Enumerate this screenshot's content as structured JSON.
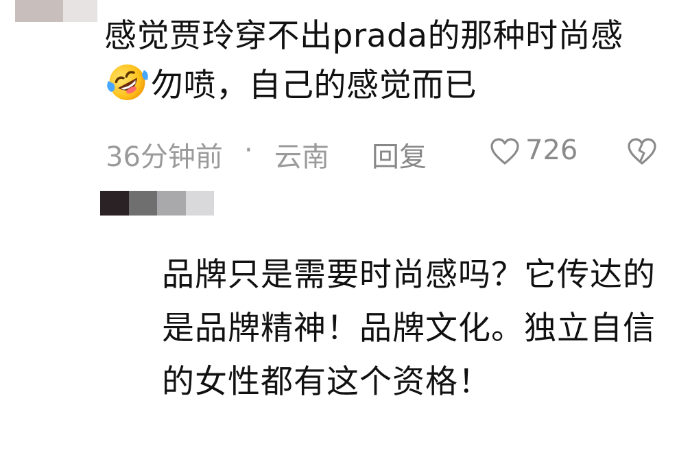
{
  "comment": {
    "text_part1": "感觉贾玲穿不出prada的那种时尚感",
    "emoji": "rolling-on-floor-laughing-emoji",
    "text_part2": "勿喷，自己的感觉而已",
    "timestamp": "36分钟前",
    "separator": "·",
    "location": "云南",
    "reply_label": "回复",
    "like_count": "726"
  },
  "reply": {
    "text": "品牌只是需要时尚感吗？它传达的是品牌精神！品牌文化。独立自信的女性都有这个资格！"
  },
  "colors": {
    "text": "#111111",
    "meta": "#9a9a9a",
    "avatar_pixels": [
      "#2a2224",
      "#6f6f6f",
      "#a9a9ab",
      "#d9d9db"
    ],
    "top_avatar_pixels": [
      "#c8bfbc",
      "#e6e3e2"
    ]
  },
  "icons": {
    "like": "heart-outline-icon",
    "dislike": "broken-heart-outline-icon"
  }
}
